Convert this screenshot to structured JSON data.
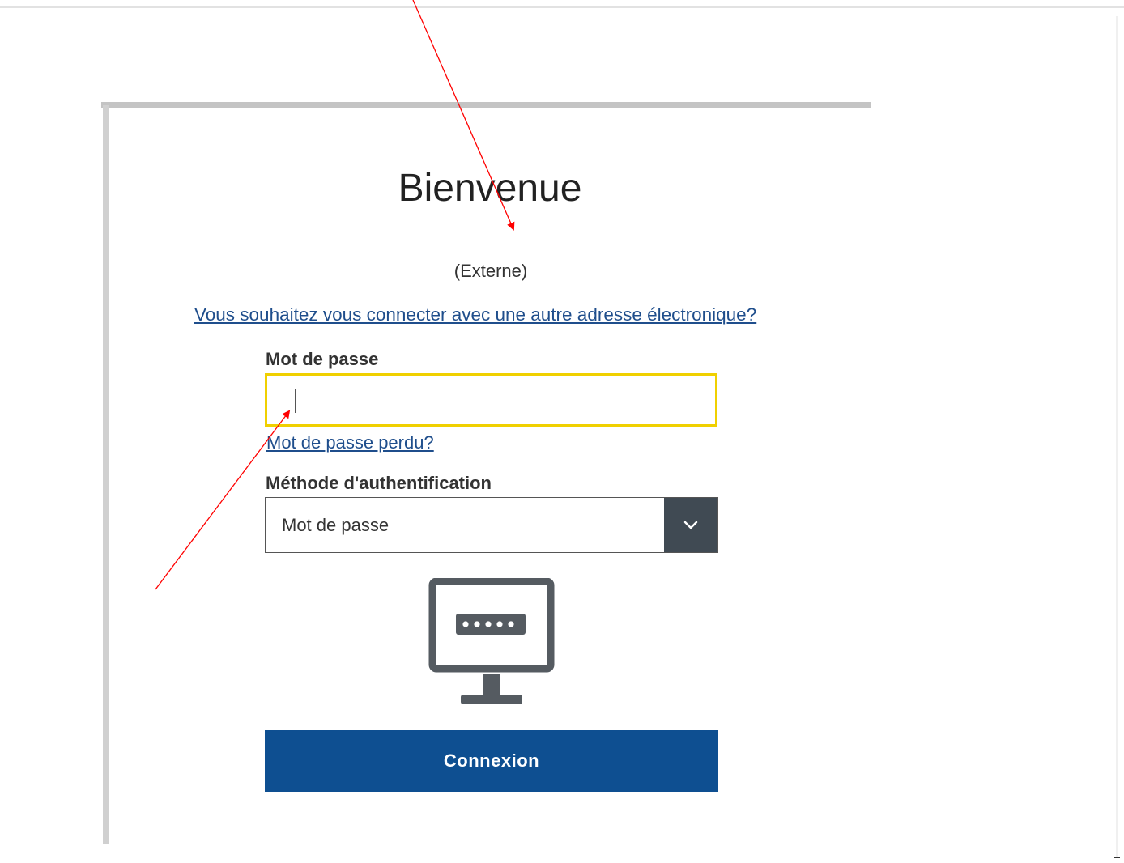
{
  "login": {
    "title": "Bienvenue",
    "subtitle": "(Externe)",
    "alt_email_link": "Vous souhaitez vous connecter avec une autre adresse électronique?",
    "password_label": "Mot de passe",
    "password_value": "",
    "lost_password_link": "Mot de passe perdu?",
    "auth_method_label": "Méthode d'authentification",
    "auth_method_selected": "Mot de passe",
    "auth_method_icon": "monitor-password-icon",
    "submit_label": "Connexion"
  },
  "colors": {
    "primary_button": "#0e4f91",
    "link": "#1f4e8c",
    "focus_border": "#f0d000",
    "select_arrow_bg": "#404a53",
    "annotation_arrow": "#ff0000"
  }
}
